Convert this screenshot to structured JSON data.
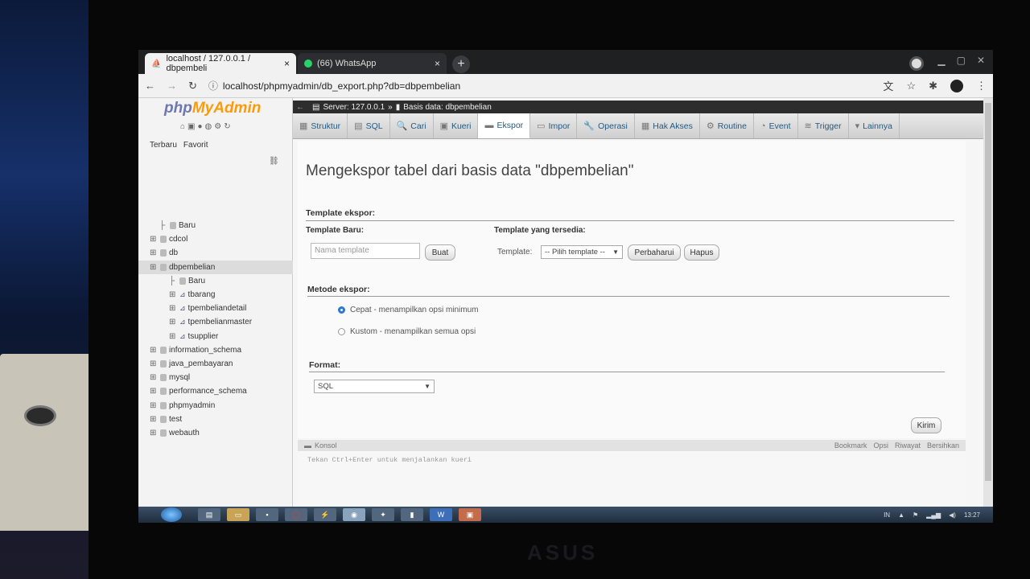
{
  "browser": {
    "tabs": [
      {
        "title": "localhost / 127.0.0.1 / dbpembeli",
        "close": "×"
      },
      {
        "title": "(66) WhatsApp",
        "close": "×"
      }
    ],
    "new_tab": "+",
    "url": "localhost/phpmyadmin/db_export.php?db=dbpembelian"
  },
  "pma": {
    "logo_a": "php",
    "logo_b": "MyAdmin",
    "links": [
      "Terbaru",
      "Favorit"
    ],
    "tree": [
      {
        "label": "Baru",
        "indent": 1
      },
      {
        "label": "cdcol",
        "indent": 0
      },
      {
        "label": "db",
        "indent": 0
      },
      {
        "label": "dbpembelian",
        "indent": 0,
        "selected": true
      },
      {
        "label": "Baru",
        "indent": 2
      },
      {
        "label": "tbarang",
        "indent": 2
      },
      {
        "label": "tpembeliandetail",
        "indent": 2
      },
      {
        "label": "tpembelianmaster",
        "indent": 2
      },
      {
        "label": "tsupplier",
        "indent": 2
      },
      {
        "label": "information_schema",
        "indent": 0
      },
      {
        "label": "java_pembayaran",
        "indent": 0
      },
      {
        "label": "mysql",
        "indent": 0
      },
      {
        "label": "performance_schema",
        "indent": 0
      },
      {
        "label": "phpmyadmin",
        "indent": 0
      },
      {
        "label": "test",
        "indent": 0
      },
      {
        "label": "webauth",
        "indent": 0
      }
    ],
    "breadcrumb": {
      "server": "Server: 127.0.0.1",
      "sep": "»",
      "db": "Basis data: dbpembelian"
    },
    "tabs": [
      "Struktur",
      "SQL",
      "Cari",
      "Kueri",
      "Ekspor",
      "Impor",
      "Operasi",
      "Hak Akses",
      "Routine",
      "Event",
      "Trigger",
      "Lainnya"
    ],
    "active_tab": "Ekspor"
  },
  "page": {
    "title": "Mengekspor tabel dari basis data \"dbpembelian\"",
    "template_section": "Template ekspor:",
    "new_template_label": "Template Baru:",
    "new_template_placeholder": "Nama template",
    "create_button": "Buat",
    "available_label": "Template yang tersedia:",
    "template_label": "Template:",
    "template_select": "-- Pilih template --",
    "update_button": "Perbaharui",
    "delete_button": "Hapus",
    "method_section": "Metode ekspor:",
    "method_quick": "Cepat - menampilkan opsi minimum",
    "method_custom": "Kustom - menampilkan semua opsi",
    "format_section": "Format:",
    "format_value": "SQL",
    "submit_button": "Kirim"
  },
  "console": {
    "title": "Konsol",
    "actions": [
      "Bookmark",
      "Opsi",
      "Riwayat",
      "Bersihkan"
    ],
    "hint": "Tekan Ctrl+Enter untuk menjalankan kueri"
  },
  "taskbar": {
    "lang": "IN",
    "time": "13:27"
  }
}
